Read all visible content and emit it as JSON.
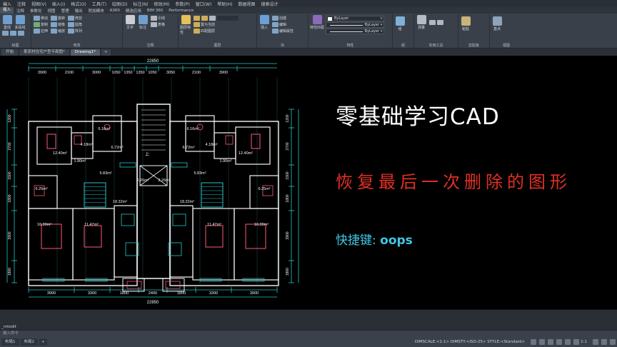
{
  "menubar": [
    "编入",
    "注释",
    "视图(V)",
    "插入(I)",
    "格式(O)",
    "工具(T)",
    "绘图(D)",
    "标注(N)",
    "修改(M)",
    "参数(P)",
    "窗口(W)",
    "帮助(H)",
    "数据视图",
    "搜索设计"
  ],
  "ribbon": {
    "tabs": [
      "插入",
      "注释",
      "参数化",
      "视图",
      "管理",
      "输出",
      "附加模块",
      "A360",
      "精选应用",
      "BIM 360",
      "Performance"
    ],
    "active_tab_index": 0,
    "panels": [
      "绘图",
      "修改",
      "注释",
      "图层",
      "块",
      "特性",
      "组",
      "实用工具",
      "剪贴板",
      "视图"
    ],
    "draw_tools": [
      "直线",
      "多段线",
      "圆",
      "圆弧"
    ],
    "modify_tools": [
      "移动",
      "旋转",
      "修剪",
      "复制",
      "镜像",
      "圆角",
      "拉伸",
      "缩放",
      "阵列"
    ],
    "annot_tools": [
      "文字",
      "标注",
      "引线",
      "表格"
    ],
    "layer_tools": [
      "图层特性",
      "置为当前",
      "匹配图层"
    ],
    "block_tools": [
      "插入",
      "创建",
      "编辑",
      "编辑属性"
    ],
    "props": {
      "match_label": "特性匹配",
      "bylayer": "ByLayer"
    },
    "util_labels": [
      "测量",
      "组",
      "粘贴",
      "基点"
    ]
  },
  "filetabs": [
    "开始",
    "Drawing1*"
  ],
  "filetab_first": "某农村住宅户型平面图*",
  "plan": {
    "top_total": "22850",
    "top_dims": [
      "3900",
      "2100",
      "3000",
      "1050",
      "1350",
      "1350",
      "1050",
      "3050",
      "2100",
      "3900"
    ],
    "bottom_total": "22850",
    "bottom_dims": [
      "3900",
      "3300",
      "1800",
      "2400",
      "1800",
      "3300",
      "3900"
    ],
    "left_dims": [
      "1200",
      "2700",
      "1500",
      "1800",
      "3900",
      "1800"
    ],
    "right_dims": [
      "1200",
      "2700",
      "1500",
      "1800",
      "3900",
      "1800"
    ],
    "room_labels": [
      "6.16m²",
      "6.16m²",
      "12.40m²",
      "12.40m²",
      "4.18m²",
      "4.18m²",
      "6.72m²",
      "6.72m²",
      "1.90m²",
      "1.90m²",
      "5.83m²",
      "5.83m²",
      "2.26m²",
      "2.26m²",
      "6.25m²",
      "6.25m²",
      "18.32m²",
      "18.32m²",
      "16.39m²",
      "16.39m²",
      "11.47m²",
      "11.47m²"
    ],
    "up_label": "上"
  },
  "title": "零基础学习CAD",
  "subtitle": "恢复最后一次删除的图形",
  "shortcut_label": "快捷键:",
  "shortcut_cmd": "oops",
  "command": {
    "history": "_mtedit",
    "placeholder": "键入命令"
  },
  "statusbar": {
    "tabs": [
      "布局1",
      "布局2"
    ],
    "dimscale": "DIMSCALE:<1:1> DIMSTY:<ISO-25> STYLE:<Standard>",
    "scale": "1:1"
  },
  "colors": {
    "wall": "#f5f5f5",
    "dim": "#25c7c7",
    "furniture": "#ff5a78",
    "accent": "#3b82f6",
    "title": "#ffffff",
    "subtitle": "#e23024",
    "shortcut": "#41c7e6"
  }
}
